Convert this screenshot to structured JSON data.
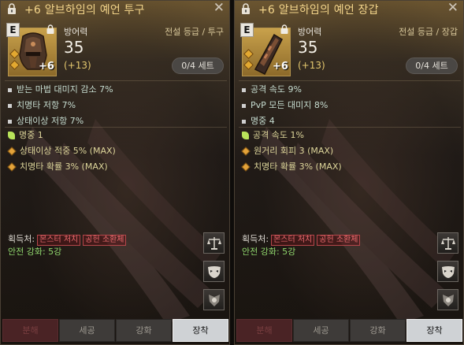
{
  "panels": [
    {
      "title": "+6 알브하임의 예언 투구",
      "grade_badge": "E",
      "enhance_level": "+6",
      "stat_label": "방어력",
      "stat_value": "35",
      "stat_bonus": "(+13)",
      "grade_type": "전설 등급 / 투구",
      "set_label": "0/4 세트",
      "main_stats": [
        "받는 마법 대미지 감소 7%",
        "치명타 저항 7%",
        "상태이상 저항 7%"
      ],
      "sub_stats": [
        {
          "icon": "leaf-icon",
          "text": "명중 1"
        },
        {
          "icon": "diamond-icon",
          "text": "상태이상 적중 5% (MAX)"
        },
        {
          "icon": "diamond-icon",
          "text": "치명타 확률 3% (MAX)"
        }
      ],
      "acquire_label": "획득처:",
      "acquire_tags": [
        "몬스터 처치",
        "공헌 소환체"
      ],
      "safe_enhance": "안전 강화: 5강",
      "buttons": [
        "분해",
        "세공",
        "강화",
        "장착"
      ],
      "icon_type": "helmet-icon"
    },
    {
      "title": "+6 알브하임의 예언 장갑",
      "grade_badge": "E",
      "enhance_level": "+6",
      "stat_label": "방어력",
      "stat_value": "35",
      "stat_bonus": "(+13)",
      "grade_type": "전설 등급 / 장갑",
      "set_label": "0/4 세트",
      "main_stats": [
        "공격 속도 9%",
        "PvP 모든 대미지 8%",
        "명중 4"
      ],
      "sub_stats": [
        {
          "icon": "leaf-icon",
          "text": "공격 속도 1%"
        },
        {
          "icon": "diamond-icon",
          "text": "원거리 회피 3 (MAX)"
        },
        {
          "icon": "diamond-icon",
          "text": "치명타 확률 3% (MAX)"
        }
      ],
      "acquire_label": "획득처:",
      "acquire_tags": [
        "몬스터 처치",
        "공헌 소환체"
      ],
      "safe_enhance": "안전 강화: 5강",
      "buttons": [
        "분해",
        "세공",
        "강화",
        "장착"
      ],
      "icon_type": "gauntlet-icon"
    }
  ],
  "colors": {
    "title": "#f2d48a",
    "bonus": "#e4c86e",
    "safe": "#8fd56c",
    "tag": "#e8696c",
    "active_button": "#cfd2d5"
  }
}
